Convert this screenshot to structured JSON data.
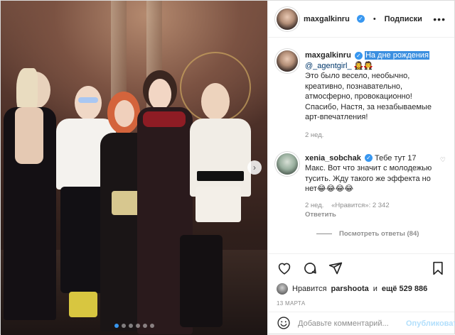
{
  "header": {
    "username": "maxgalkinru",
    "separator": "•",
    "follow_label": "Подписки",
    "more_icon": "more-options-icon"
  },
  "caption": {
    "username": "maxgalkinru",
    "highlighted": "На дне рождения",
    "mention": "@_agentgirl_",
    "emoji": "🧛‍♀️🧛",
    "text": "Это было весело, необычно, креативно, познавательно, атмосферно, провокационно! Спасибо, Настя, за незабываемые арт-впечатления!",
    "time": "2 нед."
  },
  "comment": {
    "username": "xenia_sobchak",
    "text": "Тебе тут 17 Макс. Вот что значит с молодежью тусить. Жду такого же эффекта но нет😂😂😂😂",
    "time": "2 нед.",
    "likes": "«Нравится»: 2 342",
    "reply_label": "Ответить",
    "view_replies": "Посмотреть ответы (84)"
  },
  "likes": {
    "prefix": "Нравится",
    "user": "parshoota",
    "and": "и",
    "others": "ещё 529 886"
  },
  "date": "13 МАРТА",
  "add_comment": {
    "placeholder": "Добавьте комментарий...",
    "publish_label": "Опубликовать"
  },
  "colors": {
    "accent": "#3897f0",
    "highlight": "#3b8fe0",
    "muted": "#8e8e8e",
    "publish_disabled": "#b2dffc"
  },
  "carousel": {
    "slides": 6,
    "active": 1
  }
}
